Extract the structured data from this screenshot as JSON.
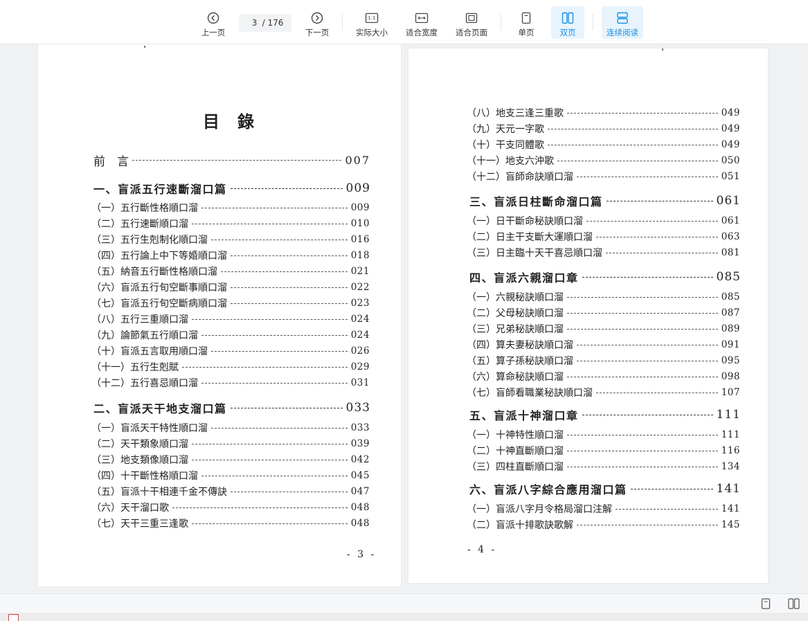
{
  "toolbar": {
    "prev_label": "上一页",
    "page_current": "3",
    "page_total": "/ 176",
    "next_label": "下一页",
    "actual_size_label": "实际大小",
    "actual_size_icon_text": "1:1",
    "fit_width_label": "适合宽度",
    "fit_page_label": "适合页面",
    "single_page_label": "单页",
    "double_page_label": "双页",
    "continuous_label": "连续阅读",
    "active_color": "#1a8fe3"
  },
  "left_page": {
    "title": "目錄",
    "preface": {
      "label": "前　言",
      "page": "007"
    },
    "sections": [
      {
        "title": "一、盲派五行速斷溜口篇",
        "page": "009",
        "items": [
          {
            "label": "（一）五行斷性格順口溜",
            "page": "009"
          },
          {
            "label": "（二）五行速斷順口溜",
            "page": "010"
          },
          {
            "label": "（三）五行生剋制化順口溜",
            "page": "016"
          },
          {
            "label": "（四）五行論上中下等婚順口溜",
            "page": "018"
          },
          {
            "label": "（五）納音五行斷性格順口溜",
            "page": "021"
          },
          {
            "label": "（六）盲派五行旬空斷事順口溜",
            "page": "022"
          },
          {
            "label": "（七）盲派五行旬空斷病順口溜",
            "page": "023"
          },
          {
            "label": "（八）五行三重順口溜",
            "page": "024"
          },
          {
            "label": "（九）論節氣五行順口溜",
            "page": "024"
          },
          {
            "label": "（十）盲派五言取用順口溜",
            "page": "026"
          },
          {
            "label": "（十一）五行生剋賦",
            "page": "029"
          },
          {
            "label": "（十二）五行喜忌順口溜",
            "page": "031"
          }
        ]
      },
      {
        "title": "二、盲派天干地支溜口篇",
        "page": "033",
        "items": [
          {
            "label": "（一）盲派天干特性順口溜",
            "page": "033"
          },
          {
            "label": "（二）天干類象順口溜",
            "page": "039"
          },
          {
            "label": "（三）地支類像順口溜",
            "page": "042"
          },
          {
            "label": "（四）十干斷性格順口溜",
            "page": "045"
          },
          {
            "label": "（五）盲派十干相連千金不傳訣",
            "page": "047"
          },
          {
            "label": "（六）天干溜口歌",
            "page": "048"
          },
          {
            "label": "（七）天干三重三逢歌",
            "page": "048"
          }
        ]
      }
    ],
    "page_number": "- 3 -"
  },
  "right_page": {
    "top_items": [
      {
        "label": "（八）地支三逢三重歌",
        "page": "049"
      },
      {
        "label": "（九）天元一字歌",
        "page": "049"
      },
      {
        "label": "（十）干支同體歌",
        "page": "049"
      },
      {
        "label": "（十一）地支六沖歌",
        "page": "050"
      },
      {
        "label": "（十二）盲師命訣順口溜",
        "page": "051"
      }
    ],
    "sections": [
      {
        "title": "三、盲派日柱斷命溜口篇",
        "page": "061",
        "items": [
          {
            "label": "（一）日干斷命秘訣順口溜",
            "page": "061"
          },
          {
            "label": "（二）日主干支斷大運順口溜",
            "page": "063"
          },
          {
            "label": "（三）日主臨十天干喜忌順口溜",
            "page": "081"
          }
        ]
      },
      {
        "title": "四、盲派六親溜口章",
        "page": "085",
        "items": [
          {
            "label": "（一）六親秘訣順口溜",
            "page": "085"
          },
          {
            "label": "（二）父母秘訣順口溜",
            "page": "087"
          },
          {
            "label": "（三）兄弟秘訣順口溜",
            "page": "089"
          },
          {
            "label": "（四）算夫妻秘訣順口溜",
            "page": "091"
          },
          {
            "label": "（五）算子孫秘訣順口溜",
            "page": "095"
          },
          {
            "label": "（六）算命秘訣順口溜",
            "page": "098"
          },
          {
            "label": "（七）盲師看職業秘訣順口溜",
            "page": "107"
          }
        ]
      },
      {
        "title": "五、盲派十神溜口章",
        "page": "111",
        "items": [
          {
            "label": "（一）十神特性順口溜",
            "page": "111"
          },
          {
            "label": "（二）十神直斷順口溜",
            "page": "116"
          },
          {
            "label": "（三）四柱直斷順口溜",
            "page": "134"
          }
        ]
      },
      {
        "title": "六、盲派八字綜合應用溜口篇",
        "page": "141",
        "items": [
          {
            "label": "（一）盲派八字月令格局溜口注解",
            "page": "141"
          },
          {
            "label": "（二）盲派十排歌訣歌解",
            "page": "145"
          }
        ]
      }
    ],
    "page_number": "- 4 -"
  }
}
